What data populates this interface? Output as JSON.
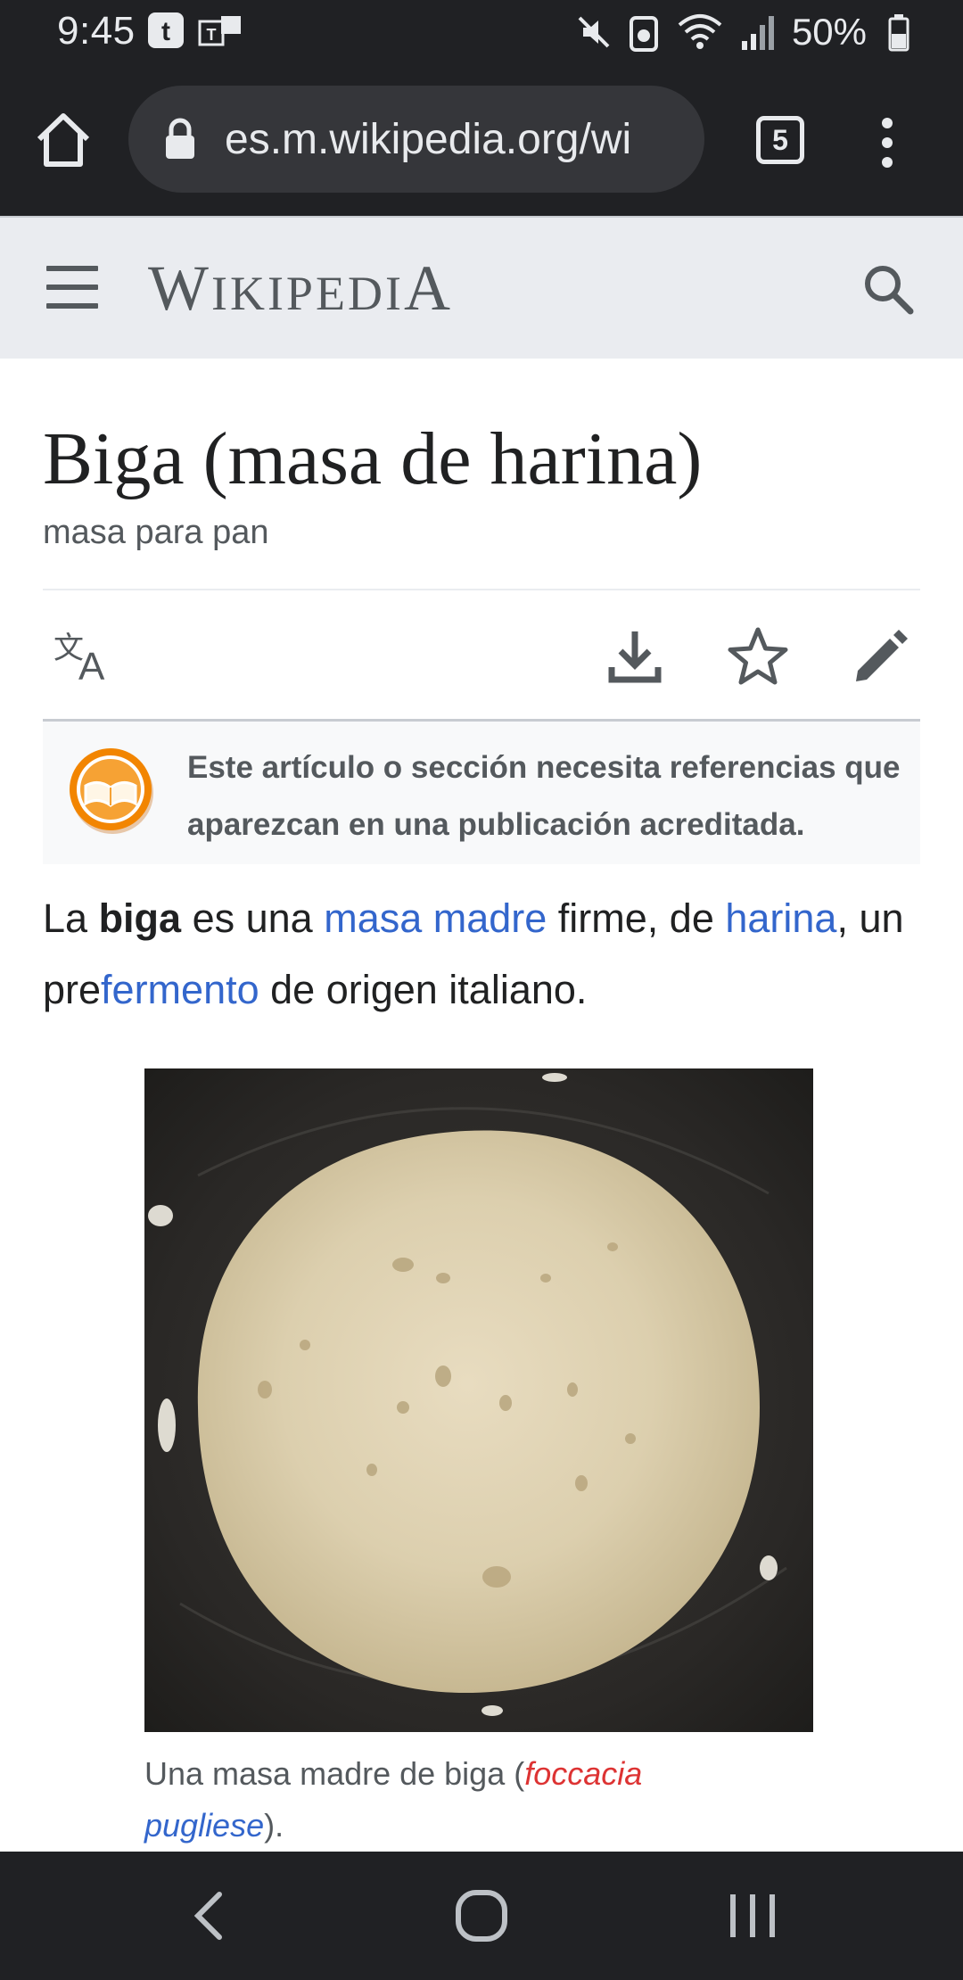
{
  "status_bar": {
    "time": "9:45",
    "battery": "50%"
  },
  "browser": {
    "url": "es.m.wikipedia.org/wi",
    "tab_count": "5"
  },
  "wiki_header": {
    "wordmark_parts": [
      "W",
      "IKIPEDI",
      "A"
    ]
  },
  "article": {
    "title": "Biga (masa de harina)",
    "subtitle": "masa para pan",
    "notice": "Este artículo o sección necesita referencias que aparezcan en una publicación acreditada.",
    "paragraph": {
      "t1": "La ",
      "bold": "biga",
      "t2": " es una ",
      "link1": "masa madre",
      "t3": " firme, de ",
      "link2": "harina",
      "t4": ", un pre",
      "link3": "fermento",
      "t5": " de origen italiano."
    },
    "caption": {
      "text": "Una masa madre de biga (",
      "link_red": "foccacia",
      "link_blue": "pugliese",
      "end": ")."
    }
  },
  "colors": {
    "link": "#3366cc",
    "redlink": "#dd3333",
    "chrome_dark": "#202124",
    "header_bg": "#eaecf0",
    "notice_orange": "#f28500"
  }
}
